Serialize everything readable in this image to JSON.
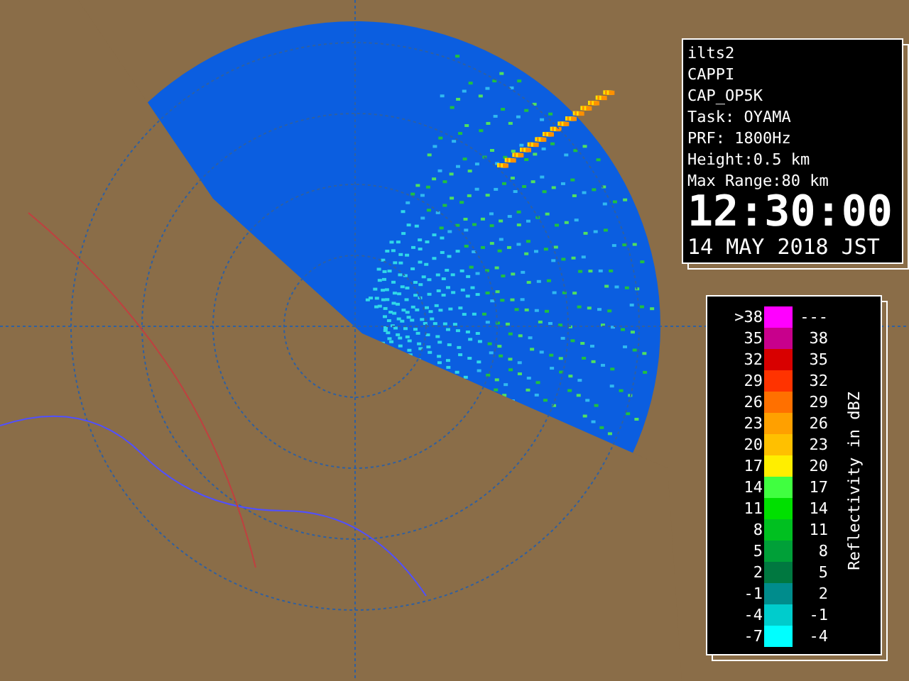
{
  "info_panel": {
    "lines": [
      "ilts2",
      "CAPPI",
      "CAP_OP5K",
      "Task: OYAMA",
      "PRF: 1800Hz",
      "Height:0.5 km",
      "Max Range:80 km"
    ],
    "time": "12:30:00",
    "date": "14 MAY 2018 JST"
  },
  "legend": {
    "title": "Reflectivity in dBZ",
    "rows": [
      {
        "low": ">38",
        "high": "---",
        "color": "#ff00ff"
      },
      {
        "low": "35",
        "high": "38",
        "color": "#c8008c"
      },
      {
        "low": "32",
        "high": "35",
        "color": "#d80000"
      },
      {
        "low": "29",
        "high": "32",
        "color": "#ff3300"
      },
      {
        "low": "26",
        "high": "29",
        "color": "#ff7000"
      },
      {
        "low": "23",
        "high": "26",
        "color": "#ffa000"
      },
      {
        "low": "20",
        "high": "23",
        "color": "#ffc000"
      },
      {
        "low": "17",
        "high": "20",
        "color": "#ffee00"
      },
      {
        "low": "14",
        "high": "17",
        "color": "#40ff40"
      },
      {
        "low": "11",
        "high": "14",
        "color": "#00e000"
      },
      {
        "low": "8",
        "high": "11",
        "color": "#00c020"
      },
      {
        "low": "5",
        "high": "8",
        "color": "#00a038"
      },
      {
        "low": "2",
        "high": "5",
        "color": "#007840"
      },
      {
        "low": "-1",
        "high": "2",
        "color": "#008c8c"
      },
      {
        "low": "-4",
        "high": "-1",
        "color": "#00cccc"
      },
      {
        "low": "-7",
        "high": "-4",
        "color": "#00ffff"
      }
    ]
  }
}
